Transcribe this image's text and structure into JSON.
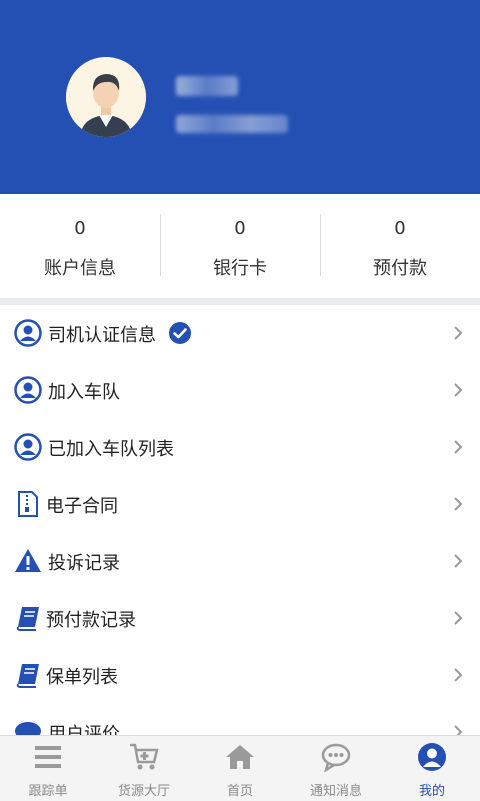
{
  "colors": {
    "header": "#2450b4",
    "accent": "#2450b4",
    "inactive_tab": "#8a8a8a"
  },
  "stats": [
    {
      "value": "0",
      "label": "账户信息"
    },
    {
      "value": "0",
      "label": "银行卡"
    },
    {
      "value": "0",
      "label": "预付款"
    }
  ],
  "menu": [
    {
      "label": "司机认证信息",
      "icon": "user-circle-icon"
    },
    {
      "label": "加入车队",
      "icon": "user-circle-icon"
    },
    {
      "label": "已加入车队列表",
      "icon": "user-circle-icon"
    },
    {
      "label": "电子合同",
      "icon": "document-zip-icon"
    },
    {
      "label": "投诉记录",
      "icon": "warning-icon"
    },
    {
      "label": "预付款记录",
      "icon": "book-icon"
    },
    {
      "label": "保单列表",
      "icon": "book-icon"
    },
    {
      "label": "用户评价",
      "icon": "chat-icon"
    }
  ],
  "tabs": [
    {
      "label": "跟踪单",
      "icon": "menu-lines-icon"
    },
    {
      "label": "货源大厅",
      "icon": "cart-icon"
    },
    {
      "label": "首页",
      "icon": "home-icon"
    },
    {
      "label": "通知消息",
      "icon": "message-icon"
    },
    {
      "label": "我的",
      "icon": "profile-icon"
    }
  ]
}
